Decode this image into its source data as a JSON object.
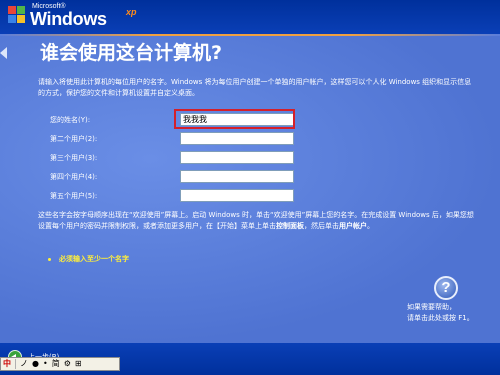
{
  "brand": {
    "small": "Microsoft®",
    "name": "Windows",
    "xp": "xp"
  },
  "title": "谁会使用这台计算机?",
  "description": "请输入将使用此计算机的每位用户的名字。Windows 将为每位用户创建一个单独的用户帐户，这样您可以个人化 Windows 组织和显示信息的方式，保护您的文件和计算机设置并自定义桌面。",
  "fields": [
    {
      "label": "您的姓名(Y):",
      "value": "我我我"
    },
    {
      "label": "第二个用户(2):",
      "value": ""
    },
    {
      "label": "第三个用户(3):",
      "value": ""
    },
    {
      "label": "第四个用户(4):",
      "value": ""
    },
    {
      "label": "第五个用户(5):",
      "value": ""
    }
  ],
  "note": {
    "part1": "这些名字会按字母顺序出现在“欢迎使用”屏幕上。启动 Windows 时，单击“欢迎使用”屏幕上您的名字。在完成设置 Windows 后，如果您想设置每个用户的密码并限制权限，或者添加更多用户，在【开始】菜单上单击",
    "bold1": "控制面板",
    "part2": "，然后单击",
    "bold2": "用户帐户",
    "part3": "。"
  },
  "required": "必须输入至少一个名字",
  "help": {
    "icon": "?",
    "line1": "如果需要帮助，",
    "line2": "请单击此处或按 F1。"
  },
  "back_label": "上一步(B)",
  "ime": {
    "lang": "中",
    "items": [
      "ノ",
      "●",
      "•",
      "简",
      "⚙",
      "⊞"
    ]
  }
}
